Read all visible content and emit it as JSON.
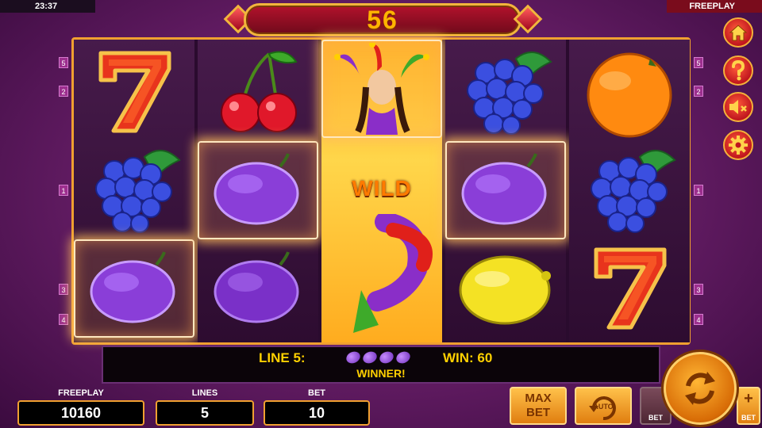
{
  "status_bar": {
    "time": "23:37",
    "mode": "FREEPLAY"
  },
  "counter": {
    "value": "56"
  },
  "reels": {
    "wild_label": "WILD",
    "symbols": [
      [
        "seven",
        "grapes",
        "plum"
      ],
      [
        "cherries",
        "plum",
        "plum"
      ],
      [
        "joker",
        "wild",
        "wild"
      ],
      [
        "grapes",
        "plum",
        "lemon"
      ],
      [
        "orange",
        "grapes",
        "seven"
      ]
    ],
    "highlighted": [
      "reel1-row3",
      "reel2-row2",
      "reel3-row1",
      "reel4-row2"
    ]
  },
  "line_markers": {
    "left": [
      "5",
      "2",
      "1",
      "3",
      "4"
    ],
    "right": [
      "5",
      "2",
      "1",
      "3",
      "4"
    ]
  },
  "win_info": {
    "line_label": "LINE 5:",
    "win_label": "WIN: 60",
    "status": "WINNER!"
  },
  "stats": {
    "credits_label": "FREEPLAY",
    "credits_value": "10160",
    "lines_label": "LINES",
    "lines_value": "5",
    "bet_label": "BET",
    "bet_value": "10"
  },
  "controls": {
    "max_bet_line1": "MAX",
    "max_bet_line2": "BET",
    "auto_label": "AUTO",
    "bet_down_label": "BET",
    "bet_up_symbol": "+",
    "bet_up_label": "BET"
  },
  "side_menu": {
    "icons": [
      "home-icon",
      "help-icon",
      "sound-muted-icon",
      "settings-icon"
    ]
  },
  "colors": {
    "background": "#6a1f6a",
    "gold": "#f0a030",
    "win_text": "#ffd000",
    "wild_bg": "#ffc52e",
    "side_button": "#c0161e"
  }
}
